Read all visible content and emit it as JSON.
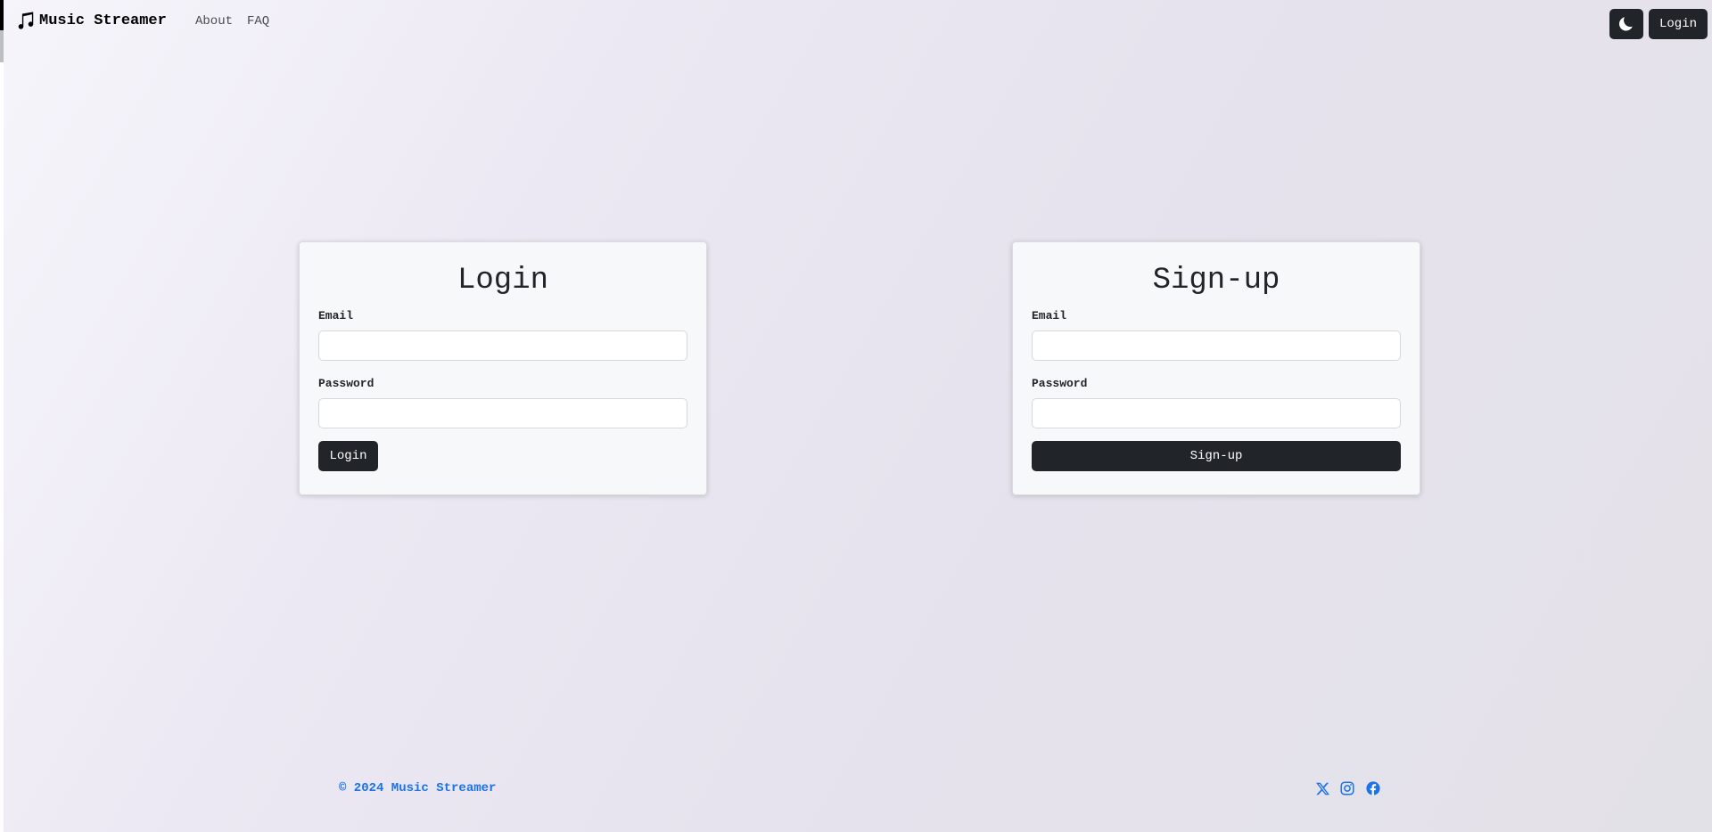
{
  "navbar": {
    "brand": "Music Streamer",
    "links": [
      "About",
      "FAQ"
    ],
    "theme_icon": "moon-icon",
    "login_label": "Login"
  },
  "login_card": {
    "title": "Login",
    "email_label": "Email",
    "email_value": "",
    "password_label": "Password",
    "password_value": "",
    "submit_label": "Login"
  },
  "signup_card": {
    "title": "Sign-up",
    "email_label": "Email",
    "email_value": "",
    "password_label": "Password",
    "password_value": "",
    "submit_label": "Sign-up"
  },
  "footer": {
    "copyright": "© 2024 Music Streamer",
    "social_icons": [
      "x-icon",
      "instagram-icon",
      "facebook-icon"
    ],
    "link_color": "#1a73e8"
  },
  "colors": {
    "button_dark": "#212529",
    "card_bg": "#f7f8fa"
  }
}
